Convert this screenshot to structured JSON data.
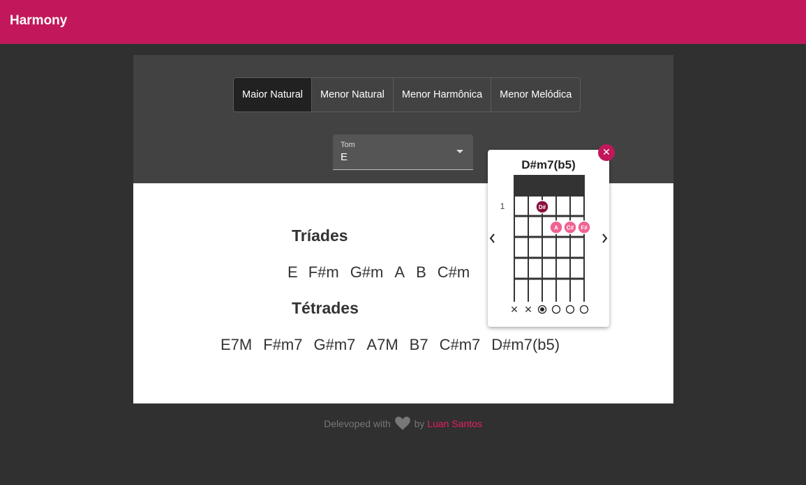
{
  "app": {
    "title": "Harmony"
  },
  "tabs": [
    {
      "label": "Maior Natural",
      "active": true
    },
    {
      "label": "Menor Natural",
      "active": false
    },
    {
      "label": "Menor Harmônica",
      "active": false
    },
    {
      "label": "Menor Melódica",
      "active": false
    }
  ],
  "key_select": {
    "label": "Tom",
    "value": "E"
  },
  "triads": {
    "title": "Tríades",
    "chords": [
      "E",
      "F#m",
      "G#m",
      "A",
      "B",
      "C#m"
    ]
  },
  "tetrads": {
    "title": "Tétrades",
    "chords": [
      "E7M",
      "F#m7",
      "G#m7",
      "A7M",
      "B7",
      "C#m7",
      "D#m7(b5)"
    ]
  },
  "chord_popup": {
    "chord_name": "D#m7(b5)",
    "close_icon": "close-icon",
    "prev_icon": "chevron-left-icon",
    "next_icon": "chevron-right-icon",
    "fret_number": "1",
    "fingering": [
      {
        "string": 3,
        "fret": 1,
        "note": "D#",
        "root": true
      },
      {
        "string": 4,
        "fret": 2,
        "note": "A",
        "root": false
      },
      {
        "string": 5,
        "fret": 2,
        "note": "C#",
        "root": false
      },
      {
        "string": 6,
        "fret": 2,
        "note": "F#",
        "root": false
      }
    ],
    "string_status": [
      "muted",
      "muted",
      "root",
      "open",
      "open",
      "open"
    ]
  },
  "footer": {
    "text": "Delevoped with",
    "by": "by",
    "author": "Luan Santos",
    "heart_icon": "heart-icon"
  },
  "colors": {
    "brand": "#c2185b",
    "accent": "#e91e63",
    "root_note": "#8b0f3e",
    "note": "#f06292"
  }
}
